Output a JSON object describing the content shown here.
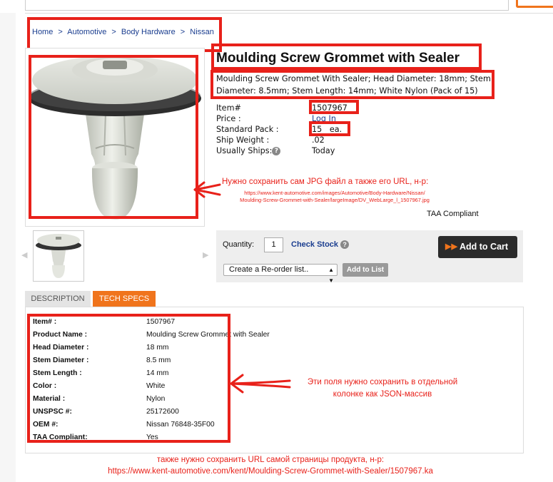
{
  "breadcrumb": [
    {
      "label": "Home"
    },
    {
      "label": "Automotive"
    },
    {
      "label": "Body Hardware"
    },
    {
      "label": "Nissan"
    }
  ],
  "breadcrumb_separator": ">",
  "product": {
    "title": "Moulding Screw Grommet with Sealer",
    "description": "Moulding Screw Grommet With Sealer; Head Diameter: 18mm; Stem Diameter: 8.5mm; Stem Length: 14mm; White Nylon  (Pack of 15)",
    "specs": [
      {
        "label": "Item#",
        "value": "1507967"
      },
      {
        "label": "Price :",
        "value": "Log In"
      },
      {
        "label": "Standard Pack :",
        "value": "15   ea."
      },
      {
        "label": "Ship Weight :",
        "value": ".02"
      },
      {
        "label": "Usually Ships:",
        "value": "Today"
      }
    ],
    "help_glyph": "?",
    "taa": "TAA Compliant"
  },
  "annotations": {
    "image_note": "Нужно сохранить сам JPG файл а также его URL, н-р:",
    "image_url": "https://www.kent-automotive.com/images/Automotive/Body-Hardware/Nissan/\nMoulding-Screw-Grommet-with-Sealer/largeImage/DV_WebLarge_l_1507967.jpg",
    "specs_note": "Эти поля нужно сохранить в отдельной колонке как JSON-массив",
    "page_note": "также нужно сохранить URL самой страницы продукта, н-р:",
    "page_url": "https://www.kent-automotive.com/kent/Moulding-Screw-Grommet-with-Sealer/1507967.ka"
  },
  "cart": {
    "quantity_label": "Quantity:",
    "quantity_value": "1",
    "check_stock": "Check Stock",
    "add_to_cart": "Add to Cart",
    "reorder_placeholder": "Create a Re-order list..",
    "add_to_list": "Add to List"
  },
  "tabs": [
    {
      "label": "DESCRIPTION",
      "active": false
    },
    {
      "label": "TECH SPECS",
      "active": true
    }
  ],
  "tech_specs": [
    {
      "key": "Item# :",
      "value": "1507967"
    },
    {
      "key": "Product Name :",
      "value": "Moulding Screw Grommet with Sealer"
    },
    {
      "key": "Head Diameter :",
      "value": "18 mm"
    },
    {
      "key": "Stem Diameter :",
      "value": "8.5 mm"
    },
    {
      "key": "Stem Length :",
      "value": "14 mm"
    },
    {
      "key": "Color :",
      "value": "White"
    },
    {
      "key": "Material :",
      "value": "Nylon"
    },
    {
      "key": "UNSPSC #:",
      "value": "25172600"
    },
    {
      "key": "OEM #:",
      "value": "Nissan 76848-35F00"
    },
    {
      "key": "TAA Compliant:",
      "value": "Yes"
    }
  ],
  "colors": {
    "annotation_red": "#e8211a",
    "accent_orange": "#f0741c",
    "link_blue": "#1a3d8f",
    "cart_button": "#2b2b2b"
  },
  "icons": [
    "help-icon",
    "chevron-left-icon",
    "chevron-right-icon",
    "play-arrows-icon",
    "red-arrow-icon",
    "dropdown-caret-icon"
  ]
}
